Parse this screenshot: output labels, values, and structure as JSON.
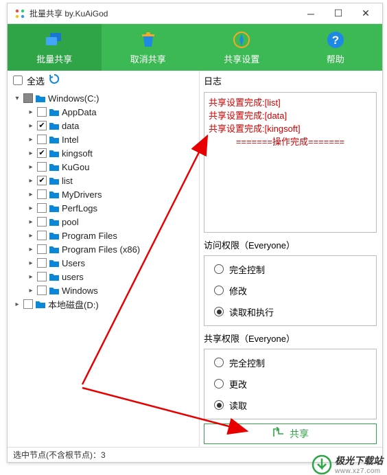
{
  "title": "批量共享 by.KuAiGod",
  "toolbar": [
    {
      "id": "batch-share",
      "label": "批量共享"
    },
    {
      "id": "cancel-share",
      "label": "取消共享"
    },
    {
      "id": "share-settings",
      "label": "共享设置"
    },
    {
      "id": "help",
      "label": "帮助"
    }
  ],
  "selectAll": "全选",
  "tree": {
    "root": {
      "label": "Windows(C:)"
    },
    "children": [
      {
        "label": "AppData",
        "checked": false
      },
      {
        "label": "data",
        "checked": true
      },
      {
        "label": "Intel",
        "checked": false
      },
      {
        "label": "kingsoft",
        "checked": true
      },
      {
        "label": "KuGou",
        "checked": false
      },
      {
        "label": "list",
        "checked": true
      },
      {
        "label": "MyDrivers",
        "checked": false
      },
      {
        "label": "PerfLogs",
        "checked": false
      },
      {
        "label": "pool",
        "checked": false
      },
      {
        "label": "Program Files",
        "checked": false
      },
      {
        "label": "Program Files (x86)",
        "checked": false
      },
      {
        "label": "Users",
        "checked": false
      },
      {
        "label": "users",
        "checked": false
      },
      {
        "label": "Windows",
        "checked": false
      }
    ],
    "drive2": {
      "label": "本地磁盘(D:)"
    }
  },
  "logLabel": "日志",
  "log": [
    "共享设置完成:[list]",
    "共享设置完成:[data]",
    "共享设置完成:[kingsoft]",
    "=======操作完成======="
  ],
  "accessPerm": {
    "label": "访问权限（Everyone）",
    "options": [
      {
        "label": "完全控制",
        "sel": false
      },
      {
        "label": "修改",
        "sel": false
      },
      {
        "label": "读取和执行",
        "sel": true
      }
    ]
  },
  "sharePerm": {
    "label": "共享权限（Everyone）",
    "options": [
      {
        "label": "完全控制",
        "sel": false
      },
      {
        "label": "更改",
        "sel": false
      },
      {
        "label": "读取",
        "sel": true
      }
    ]
  },
  "shareBtn": "共享",
  "status": "选中节点(不含根节点)：3",
  "watermark": {
    "brand": "极光下载站",
    "url": "www.xz7.com"
  }
}
